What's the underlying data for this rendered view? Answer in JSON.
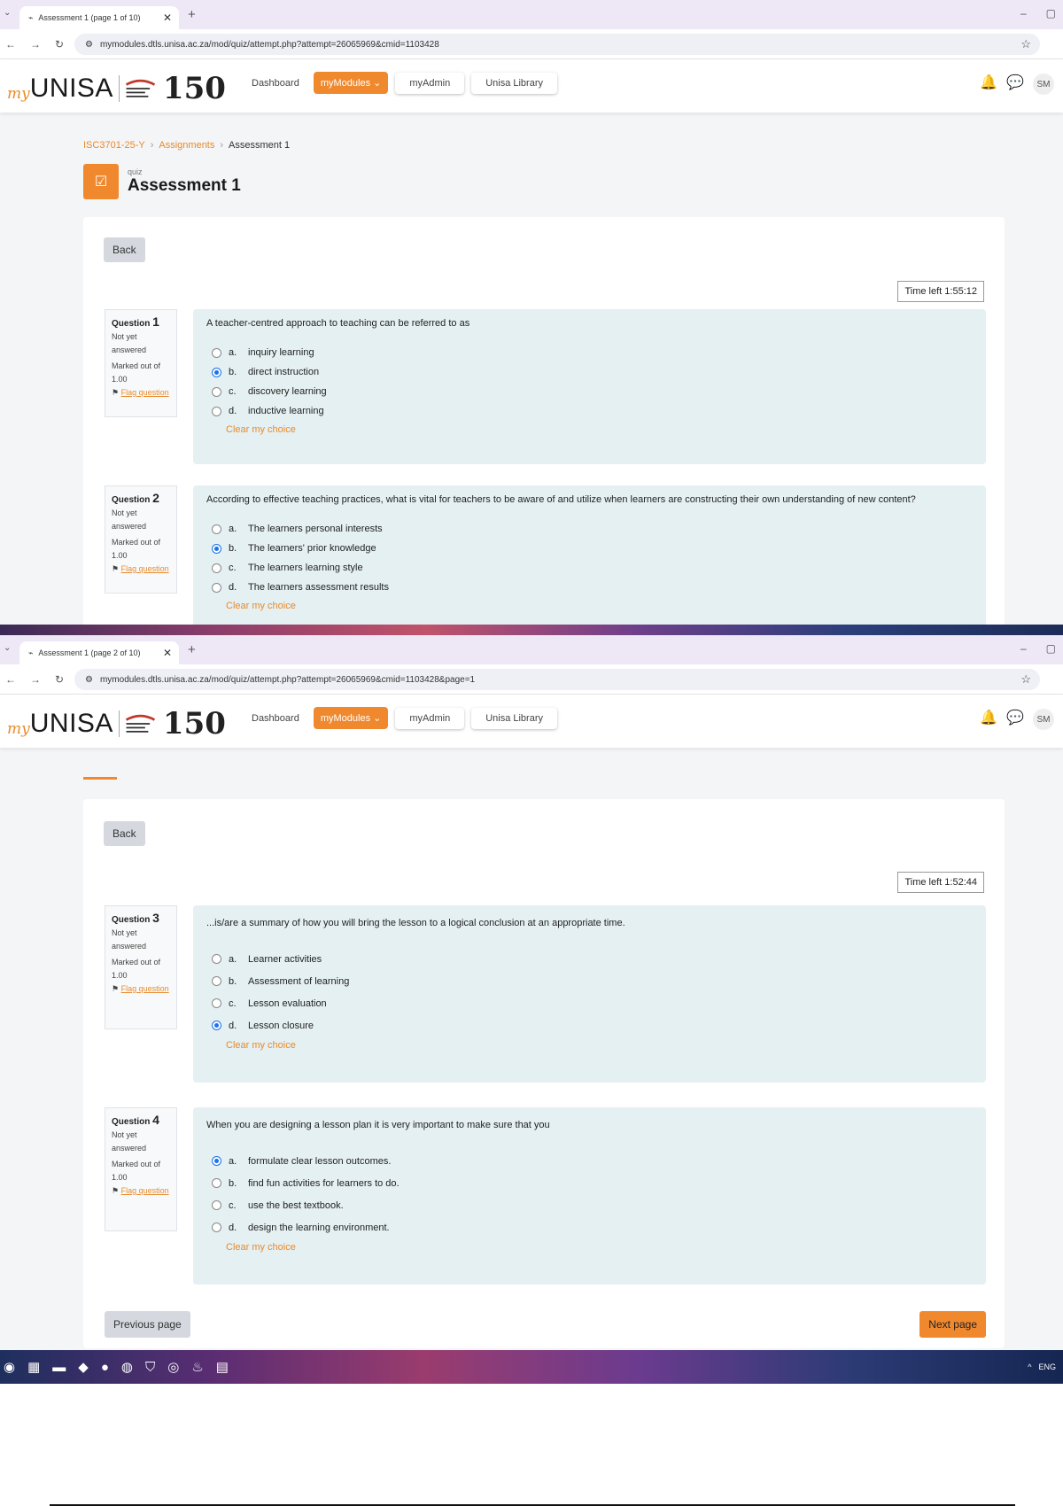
{
  "shot1": {
    "tab_title": "Assessment 1 (page 1 of 10)",
    "url": "mymodules.dtls.unisa.ac.za/mod/quiz/attempt.php?attempt=26065969&cmid=1103428",
    "timer": "Time left 1:55:12"
  },
  "shot2": {
    "tab_title": "Assessment 1 (page 2 of 10)",
    "url": "mymodules.dtls.unisa.ac.za/mod/quiz/attempt.php?attempt=26065969&cmid=1103428&page=1",
    "timer": "Time left 1:52:44"
  },
  "header": {
    "logo_my": "my",
    "logo_unisa": "UNISA",
    "logo_num": "150",
    "nav": {
      "dashboard": "Dashboard",
      "mymodules": "myModules ⌄",
      "myadmin": "myAdmin",
      "library": "Unisa Library"
    },
    "avatar": "SM"
  },
  "breadcrumb": {
    "course": "ISC3701-25-Y",
    "section": "Assignments",
    "current": "Assessment 1"
  },
  "page": {
    "type": "quiz",
    "title": "Assessment 1",
    "back": "Back"
  },
  "common": {
    "status": "Not yet answered",
    "marked": "Marked out of 1.00",
    "flag": "Flag question",
    "clear": "Clear my choice",
    "question_word": "Question"
  },
  "questions": [
    {
      "num": "1",
      "text": "A teacher-centred approach to teaching can be referred to as",
      "options": [
        {
          "l": "a.",
          "t": "inquiry learning"
        },
        {
          "l": "b.",
          "t": "direct instruction"
        },
        {
          "l": "c.",
          "t": "discovery learning"
        },
        {
          "l": "d.",
          "t": "inductive learning"
        }
      ],
      "selected": 1
    },
    {
      "num": "2",
      "text": "According to effective teaching practices, what is vital for teachers to be aware of and utilize when learners are constructing their own understanding of new content?",
      "options": [
        {
          "l": "a.",
          "t": "The learners personal interests"
        },
        {
          "l": "b.",
          "t": "The learners' prior knowledge"
        },
        {
          "l": "c.",
          "t": "The learners learning style"
        },
        {
          "l": "d.",
          "t": "The learners assessment results"
        }
      ],
      "selected": 1
    },
    {
      "num": "3",
      "text": "...is/are a summary of how you will bring the lesson to a logical conclusion at an appropriate time.",
      "options": [
        {
          "l": "a.",
          "t": "Learner activities"
        },
        {
          "l": "b.",
          "t": "Assessment of learning"
        },
        {
          "l": "c.",
          "t": "Lesson evaluation"
        },
        {
          "l": "d.",
          "t": "Lesson closure"
        }
      ],
      "selected": 3
    },
    {
      "num": "4",
      "text": "When you are designing a lesson plan it is very important to make sure that you",
      "options": [
        {
          "l": "a.",
          "t": "formulate clear lesson outcomes."
        },
        {
          "l": "b.",
          "t": "find fun activities for learners to do."
        },
        {
          "l": "c.",
          "t": "use the best textbook."
        },
        {
          "l": "d.",
          "t": "design the learning environment."
        }
      ],
      "selected": 0
    }
  ],
  "footer": {
    "prev": "Previous page",
    "next": "Next page"
  },
  "taskbar": {
    "lang": "ENG"
  }
}
